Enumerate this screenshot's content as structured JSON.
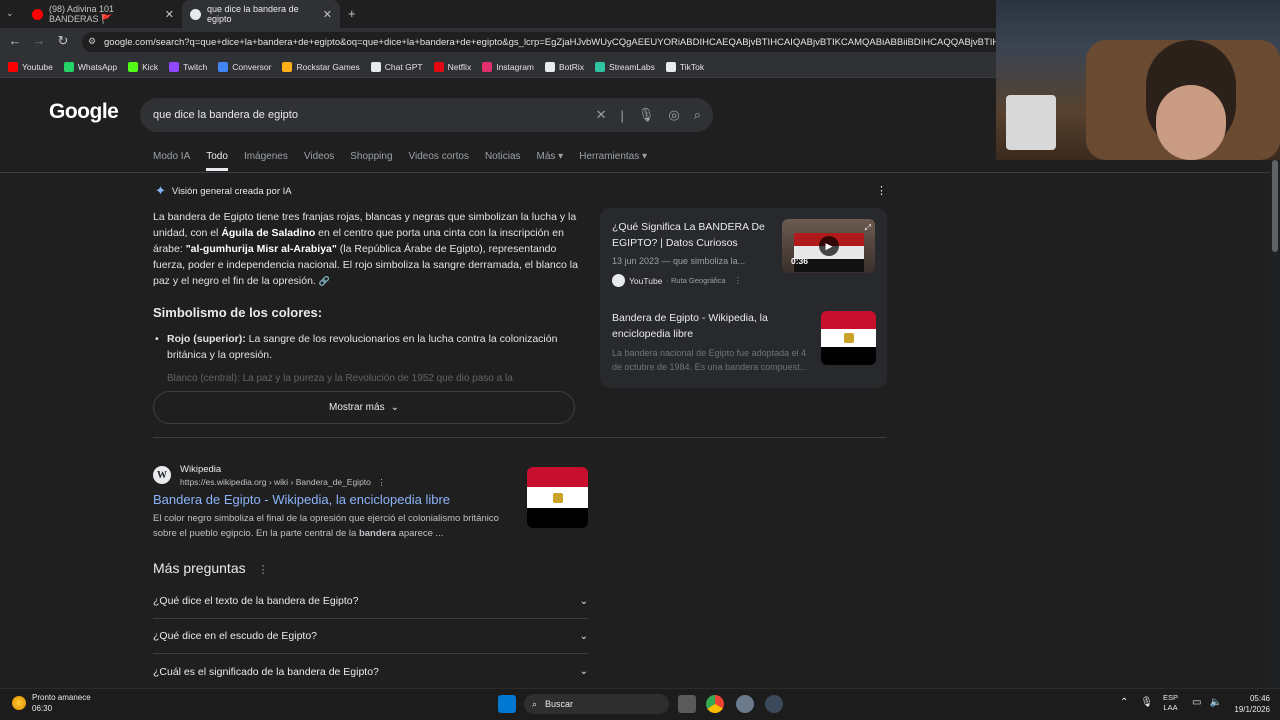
{
  "browser": {
    "tabs": [
      {
        "label": "(98) Adivina 101 BANDERAS 🚩"
      },
      {
        "label": "que dice la bandera de egipto"
      }
    ],
    "url": "google.com/search?q=que+dice+la+bandera+de+egipto&oq=que+dice+la+bandera+de+egipto&gs_lcrp=EgZjaHJvbWUyCQgAEEUYORiABDIHCAEQABjvBTIHCAIQABjvBTIKCAMQABiABBiiBDIHCAQQABjvBTIHCAUQ",
    "bookmarks": [
      "Youtube",
      "WhatsApp",
      "Kick",
      "Twitch",
      "Conversor",
      "Rockstar Games",
      "Chat GPT",
      "Netflix",
      "Instagram",
      "BotRix",
      "StreamLabs",
      "TikTok"
    ],
    "bookmark_colors": [
      "#ff0000",
      "#25d366",
      "#53fc18",
      "#9146ff",
      "#4285f4",
      "#fcaf17",
      "#e8eaed",
      "#e50914",
      "#e1306c",
      "#e8eaed",
      "#31c3a2",
      "#e8eaed"
    ]
  },
  "google": {
    "logo": "Google",
    "query": "que dice la bandera de egipto",
    "nav": [
      "Modo IA",
      "Todo",
      "Imágenes",
      "Videos",
      "Shopping",
      "Videos cortos",
      "Noticias",
      "Más ▾",
      "Herramientas ▾"
    ]
  },
  "ai": {
    "heading": "Visión general creada por IA",
    "p1": "La bandera de Egipto tiene tres franjas rojas, blancas y negras que simbolizan la lucha y la unidad, con el ",
    "p1b": "Águila de Saladino",
    "p2": " en el centro que porta una cinta con la inscripción en árabe: ",
    "p2b": "\"al-gumhurija Misr al-Arabiya\"",
    "p3": " (la República Árabe de Egipto), representando fuerza, poder e independencia nacional. El rojo simboliza la sangre derramada, el blanco la paz y el negro el fin de la opresión.",
    "section": "Simbolismo de los colores:",
    "bullet_b": "Rojo (superior):",
    "bullet": " La sangre de los revolucionarios en la lucha contra la colonización británica y la opresión.",
    "faded": "Blanco (central): La paz y la pureza y la Revolución de 1952 que dio paso a la",
    "more": "Mostrar más"
  },
  "cards": {
    "c1_title": "¿Qué Significa La BANDERA De EGIPTO? | Datos Curiosos",
    "c1_date": "13 jun 2023 — que simboliza la...",
    "c1_source": "YouTube",
    "c1_channel": "· Ruta Geográfica",
    "c1_duration": "0:36",
    "c2_title": "Bandera de Egipto - Wikipedia, la enciclopedia libre",
    "c2_snip": "La bandera nacional de Egipto fue adoptada el 4 de octubre de 1984. Es una bandera compuest..."
  },
  "result": {
    "site": "Wikipedia",
    "url": "https://es.wikipedia.org › wiki › Bandera_de_Egipto",
    "title": "Bandera de Egipto - Wikipedia, la enciclopedia libre",
    "snip1": "El color negro simboliza el final de la opresión que ejerció el colonialismo británico sobre el pueblo egipcio. En la parte central de la ",
    "snipb": "bandera",
    "snip2": " aparece ..."
  },
  "faq": {
    "title": "Más preguntas",
    "items": [
      "¿Qué dice el texto de la bandera de Egipto?",
      "¿Qué dice en el escudo de Egipto?",
      "¿Cuál es el significado de la bandera de Egipto?"
    ]
  },
  "taskbar": {
    "weather_title": "Pronto amanece",
    "weather_time": "06:30",
    "search": "Buscar",
    "lang1": "ESP",
    "lang2": "LAA",
    "time": "05:46",
    "date": "19/1/2026"
  }
}
